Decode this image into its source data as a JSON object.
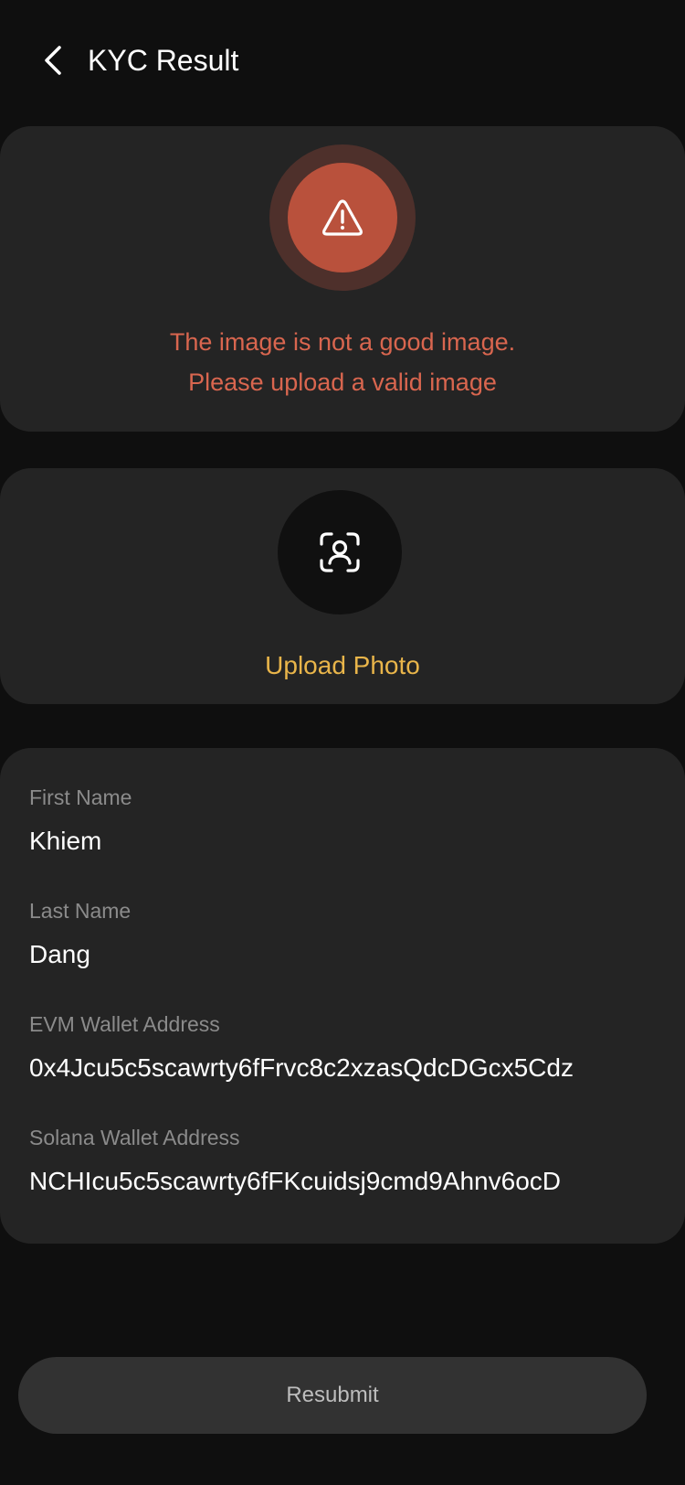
{
  "header": {
    "title": "KYC Result",
    "back_icon": "chevron-left-icon"
  },
  "error_card": {
    "icon": "warning-triangle-icon",
    "message_line1": "The image is not a good image.",
    "message_line2": "Please upload a valid image",
    "accent_color": "#d9664f"
  },
  "upload_card": {
    "icon": "face-scan-icon",
    "label": "Upload Photo",
    "accent_color": "#e9b54a"
  },
  "info_card": {
    "fields": [
      {
        "label": "First Name",
        "value": "Khiem"
      },
      {
        "label": "Last Name",
        "value": "Dang"
      },
      {
        "label": "EVM Wallet Address",
        "value": "0x4Jcu5c5scawrty6fFrvc8c2xzasQdcDGcx5Cdz"
      },
      {
        "label": "Solana Wallet Address",
        "value": "NCHIcu5c5scawrty6fFKcuidsj9cmd9Ahnv6ocD"
      }
    ]
  },
  "footer": {
    "resubmit_label": "Resubmit"
  }
}
